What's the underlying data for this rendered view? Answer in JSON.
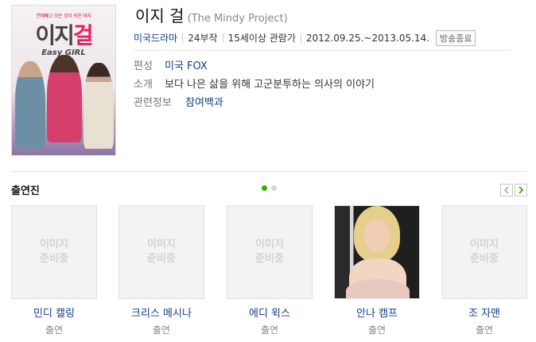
{
  "poster": {
    "tagline": "연애빼고 모든 것이 쉬운 여자",
    "logo_kr_a": "이지",
    "logo_kr_b": "걸",
    "logo_en": "Easy GIRL"
  },
  "program": {
    "title": "이지 걸",
    "original_title": "(The Mindy Project)",
    "genre": "미국드라마",
    "episodes": "24부작",
    "rating": "15세이상 관람가",
    "air_period": "2012.09.25.~2013.05.14.",
    "status": "방송종료"
  },
  "details": [
    {
      "label": "편성",
      "value": "미국 FOX",
      "is_link": true
    },
    {
      "label": "소개",
      "value": "보다 나은 삶을 위해 고군분투하는 의사의 이야기",
      "is_link": false
    },
    {
      "label": "관련정보",
      "value": "참여백과",
      "is_link": true
    }
  ],
  "cast": {
    "title": "출연진",
    "pages": 2,
    "current_page": 1,
    "prev_icon": "chevron-left-icon",
    "next_icon": "chevron-right-icon",
    "placeholder": "이미지\n준비중",
    "members": [
      {
        "name": "민디 캘링",
        "role": "출연",
        "has_photo": false
      },
      {
        "name": "크리스 메시나",
        "role": "출연",
        "has_photo": false
      },
      {
        "name": "에디 윅스",
        "role": "출연",
        "has_photo": false
      },
      {
        "name": "안나 캠프",
        "role": "출연",
        "has_photo": true
      },
      {
        "name": "조 자맨",
        "role": "출연",
        "has_photo": false
      }
    ]
  },
  "colors": {
    "link": "#163e89",
    "dot_active": "#2db400",
    "dot_inactive": "#d6d6d6",
    "next_arrow": "#2db400"
  }
}
